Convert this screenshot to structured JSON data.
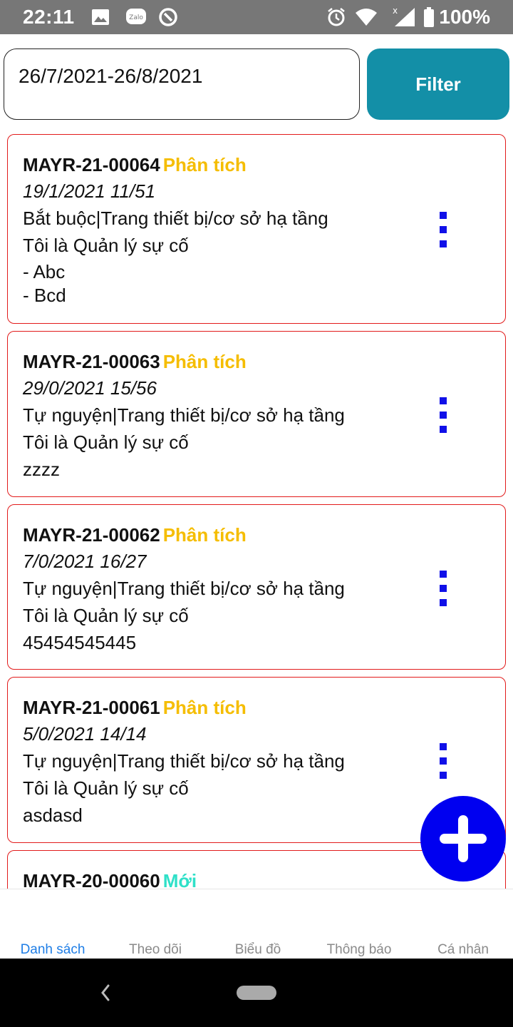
{
  "status_bar": {
    "time": "22:11",
    "left_icons": [
      "image-icon",
      "zalo-icon",
      "signal-app-icon"
    ],
    "right_icons": [
      "alarm-icon",
      "wifi-icon",
      "cell-signal-icon",
      "battery-icon"
    ],
    "battery_text": "100%"
  },
  "filter": {
    "date_range_value": "26/7/2021-26/8/2021",
    "button_label": "Filter",
    "button_color": "#138fa7"
  },
  "cards": [
    {
      "code": "MAYR-21-00064",
      "status": "Phân tích",
      "status_color": "#f5bd00",
      "date": "19/1/2021 11/51",
      "category": "Bắt buộc|Trang thiết bị/cơ sở hạ tầng",
      "role": "Tôi là Quản lý sự cố",
      "note": "- Abc\n- Bcd"
    },
    {
      "code": "MAYR-21-00063",
      "status": "Phân tích",
      "status_color": "#f5bd00",
      "date": "29/0/2021 15/56",
      "category": "Tự nguyện|Trang thiết bị/cơ sở hạ tầng",
      "role": "Tôi là Quản lý sự cố",
      "note": "zzzz"
    },
    {
      "code": "MAYR-21-00062",
      "status": "Phân tích",
      "status_color": "#f5bd00",
      "date": "7/0/2021 16/27",
      "category": "Tự nguyện|Trang thiết bị/cơ sở hạ tầng",
      "role": "Tôi là Quản lý sự cố",
      "note": "45454545445"
    },
    {
      "code": "MAYR-21-00061",
      "status": "Phân tích",
      "status_color": "#f5bd00",
      "date": "5/0/2021 14/14",
      "category": "Tự nguyện|Trang thiết bị/cơ sở hạ tầng",
      "role": "Tôi là Quản lý sự cố",
      "note": "asdasd"
    },
    {
      "code": "MAYR-20-00060",
      "status": "Mới",
      "status_color": "#2fe0c8",
      "date": "",
      "category": "",
      "role": "",
      "note": ""
    }
  ],
  "fab": {
    "icon": "plus-icon",
    "color": "#0000f0"
  },
  "tabs": [
    {
      "label": "Danh sách",
      "active": true
    },
    {
      "label": "Theo dõi",
      "active": false
    },
    {
      "label": "Biểu đồ",
      "active": false
    },
    {
      "label": "Thông báo",
      "active": false
    },
    {
      "label": "Cá nhân",
      "active": false
    }
  ],
  "colors": {
    "card_border": "#e21b1b",
    "more_dots": "#1010e8",
    "tab_active": "#1f7ee6",
    "tab_inactive": "#8a8a8a"
  }
}
